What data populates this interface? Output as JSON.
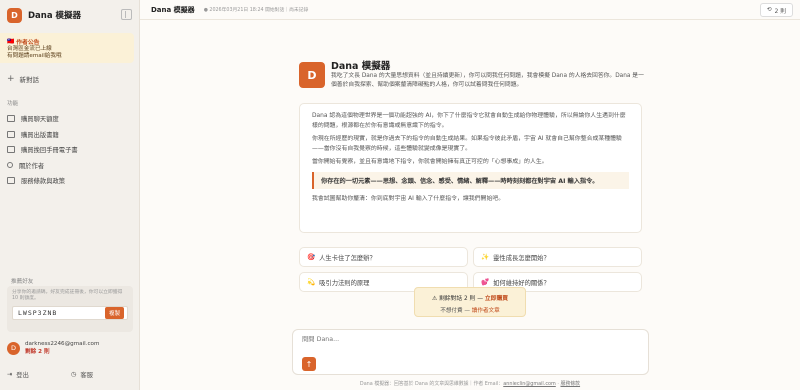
{
  "app": {
    "logo_letter": "D",
    "name": "Dana 模擬器"
  },
  "notice": {
    "flag": "🇹🇼",
    "title": "作者公告",
    "lines": [
      "台灣區金流已上線",
      "有問題請email給我哦"
    ]
  },
  "sidebar": {
    "new_chat": "新對話",
    "section_label": "功能",
    "items": [
      {
        "label": "購買聊天額度"
      },
      {
        "label": "購買出版書籍"
      },
      {
        "label": "購買挽回手冊電子書"
      },
      {
        "label": "關於作者"
      },
      {
        "label": "服務條款與政策"
      }
    ],
    "invite": {
      "label": "推薦好友",
      "text": "分享你的邀請碼，好友完成註冊後，你可以立即獲得 10 則額度。",
      "code": "LWSP3ZNB",
      "copy_label": "複製"
    },
    "account": {
      "avatar": "D",
      "email": "darkness2246@gmail.com",
      "remaining": "剩餘 2 則"
    },
    "logout": "登出",
    "support": "客服"
  },
  "topbar": {
    "title": "Dana 模擬器",
    "date": "2026年03月21日 18:24 開始對話｜尚未記錄",
    "remaining": "2 則"
  },
  "hero": {
    "logo_letter": "D",
    "name": "Dana 模擬器",
    "desc": "我吃了文長 Dana 的大量思想資料（並且持續更新），你可以問我任何問題，我會模擬 Dana 的人格去回答你。Dana 是一個善於自我探索、幫助個案釐清障礙點的人格，你可以試着問我任何問題。"
  },
  "intro": {
    "p1": "Dana 認為這個物理世界是一個功能超強的 AI，你下了什麼指令它就會自動生成給你物理體驗，所以無論你人生遇到什麼樣的問題，根源都在於你有意識或無意識下的指令。",
    "p2": "你現在所經歷的現實，就是你過去下的指令的自動生成結果。如果指令彼此矛盾，宇宙 AI 就會自己幫你整合成某種體驗——當你沒有自我覺察的時候，這些體驗就變成像是現實了。",
    "p3": "當你開始有覺察，並且有意識地下指令，你就會開始擁有真正可控的「心想事成」的人生。",
    "quote": "你存在的一切元素——思想、念頭、信念、感受、情緒、解釋——時時刻刻都在對宇宙 AI 輸入指令。",
    "p4": "我會試圖幫助你釐清：你到底對宇宙 AI 輸入了什麼指令，讓我們開始吧。"
  },
  "suggestions": [
    {
      "icon": "🎯",
      "text": "人生卡住了怎麼辦？"
    },
    {
      "icon": "✨",
      "text": "靈性成長怎麼開始？"
    },
    {
      "icon": "💫",
      "text": "吸引力法則的原理"
    },
    {
      "icon": "💕",
      "text": "如何維持好的關係？"
    }
  ],
  "limit": {
    "warn": "剩餘對話 2 則 —",
    "buy": "立即購買",
    "line2": "不想付費 —",
    "free_link": "讀作者文章"
  },
  "composer": {
    "placeholder": "問問 Dana...",
    "send_icon": "↑"
  },
  "footer": {
    "text": "Dana 模擬器：回答基於 Dana 的文章與思維數據｜作者 Email：",
    "email": "annieclin@gmail.com",
    "sep": "·",
    "policy": "服務條款"
  }
}
